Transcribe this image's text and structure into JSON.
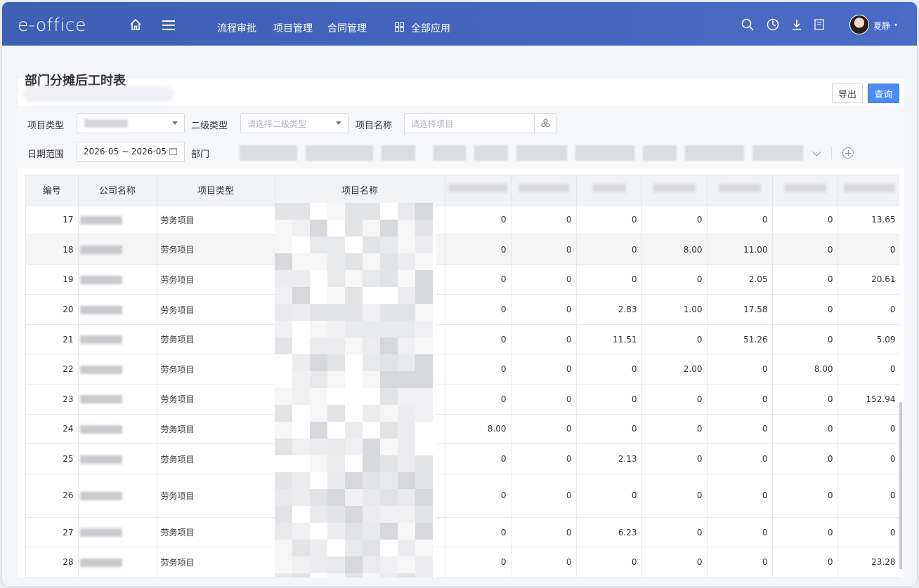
{
  "brand": {
    "logo": "e-office"
  },
  "topnav": {
    "items": [
      "流程审批",
      "项目管理",
      "合同管理"
    ],
    "all_apps": "全部应用"
  },
  "user": {
    "name": "夏静"
  },
  "page": {
    "title": "部门分摊后工时表"
  },
  "actions": {
    "export": "导出",
    "query": "查询"
  },
  "filters": {
    "project_type_label": "项目类型",
    "secondary_type_label": "二级类型",
    "secondary_type_placeholder": "请选择二级类型",
    "project_name_label": "项目名称",
    "project_name_placeholder": "请选择项目",
    "date_range_label": "日期范围",
    "date_range_value": "2026-05 ~ 2026-05",
    "department_label": "部门"
  },
  "table": {
    "headers": [
      "编号",
      "公司名称",
      "项目类型",
      "项目名称"
    ],
    "rows": [
      {
        "id": "17",
        "type": "劳务项目",
        "vals": [
          "0",
          "0",
          "0",
          "0",
          "0",
          "0",
          "13.65"
        ]
      },
      {
        "id": "18",
        "type": "劳务项目",
        "vals": [
          "0",
          "0",
          "0",
          "8.00",
          "11.00",
          "0",
          "0"
        ]
      },
      {
        "id": "19",
        "type": "劳务项目",
        "vals": [
          "0",
          "0",
          "0",
          "0",
          "2.05",
          "0",
          "20.61"
        ]
      },
      {
        "id": "20",
        "type": "劳务项目",
        "vals": [
          "0",
          "0",
          "2.83",
          "1.00",
          "17.58",
          "0",
          "0"
        ]
      },
      {
        "id": "21",
        "type": "劳务项目",
        "vals": [
          "0",
          "0",
          "11.51",
          "0",
          "51.26",
          "0",
          "5.09"
        ]
      },
      {
        "id": "22",
        "type": "劳务项目",
        "vals": [
          "0",
          "0",
          "0",
          "2.00",
          "0",
          "8.00",
          "0"
        ]
      },
      {
        "id": "23",
        "type": "劳务项目",
        "vals": [
          "0",
          "0",
          "0",
          "0",
          "0",
          "0",
          "152.94"
        ]
      },
      {
        "id": "24",
        "type": "劳务项目",
        "vals": [
          "8.00",
          "0",
          "0",
          "0",
          "0",
          "0",
          "0"
        ]
      },
      {
        "id": "25",
        "type": "劳务项目",
        "vals": [
          "0",
          "0",
          "2.13",
          "0",
          "0",
          "0",
          "0"
        ]
      },
      {
        "id": "26",
        "type": "劳务项目",
        "vals": [
          "0",
          "0",
          "0",
          "0",
          "0",
          "0",
          "0"
        ]
      },
      {
        "id": "27",
        "type": "劳务项目",
        "vals": [
          "0",
          "0",
          "6.23",
          "0",
          "0",
          "0",
          "0"
        ]
      },
      {
        "id": "28",
        "type": "劳务项目",
        "vals": [
          "0",
          "0",
          "0",
          "0",
          "0",
          "0",
          "23.28"
        ]
      }
    ]
  },
  "icons": [
    "home-icon",
    "menu-icon",
    "apps-icon",
    "search-icon",
    "dashboard-icon",
    "download-icon",
    "notes-icon",
    "calendar-icon",
    "project-picker-icon",
    "add-circle-icon",
    "chevron-down-icon"
  ]
}
